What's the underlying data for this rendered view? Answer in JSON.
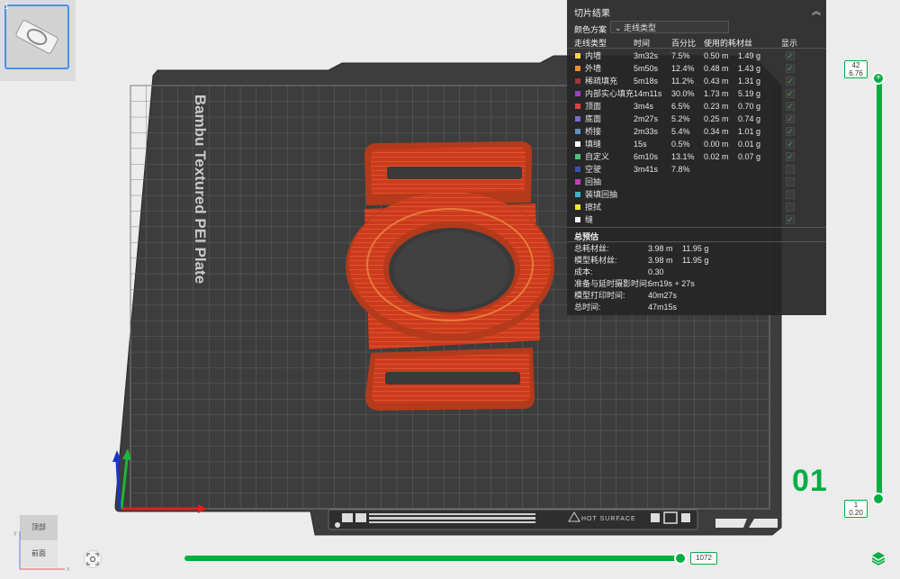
{
  "plate": {
    "thumbnail_number": "1",
    "bed_name": "Bambu Textured PEI Plate",
    "plate_number": "01",
    "hot_surface_label": "HOT SURFACE"
  },
  "stats": {
    "title": "切片结果",
    "scheme_label": "颜色方案",
    "scheme_value": "走线类型",
    "headers": {
      "type": "走线类型",
      "time": "时间",
      "percent": "百分比",
      "usage": "使用的耗材丝",
      "show": "显示"
    },
    "rows": [
      {
        "name": "内墙",
        "time": "3m32s",
        "percent": "7.5%",
        "length": "0.50 m",
        "weight": "1.49 g",
        "color": "#f5d547",
        "shown": true
      },
      {
        "name": "外墙",
        "time": "5m50s",
        "percent": "12.4%",
        "length": "0.48 m",
        "weight": "1.43 g",
        "color": "#f08c2e",
        "shown": true
      },
      {
        "name": "稀疏填充",
        "time": "5m18s",
        "percent": "11.2%",
        "length": "0.43 m",
        "weight": "1.31 g",
        "color": "#a8323a",
        "shown": true
      },
      {
        "name": "内部实心填充",
        "time": "14m11s",
        "percent": "30.0%",
        "length": "1.73 m",
        "weight": "5.19 g",
        "color": "#9b3fc2",
        "shown": true
      },
      {
        "name": "顶面",
        "time": "3m4s",
        "percent": "6.5%",
        "length": "0.23 m",
        "weight": "0.70 g",
        "color": "#e04040",
        "shown": true
      },
      {
        "name": "底面",
        "time": "2m27s",
        "percent": "5.2%",
        "length": "0.25 m",
        "weight": "0.74 g",
        "color": "#7e6ad1",
        "shown": true
      },
      {
        "name": "桥接",
        "time": "2m33s",
        "percent": "5.4%",
        "length": "0.34 m",
        "weight": "1.01 g",
        "color": "#5d8fbf",
        "shown": true
      },
      {
        "name": "填缝",
        "time": "15s",
        "percent": "0.5%",
        "length": "0.00 m",
        "weight": "0.01 g",
        "color": "#ffffff",
        "shown": true
      },
      {
        "name": "自定义",
        "time": "6m10s",
        "percent": "13.1%",
        "length": "0.02 m",
        "weight": "0.07 g",
        "color": "#4fbf7a",
        "shown": true
      },
      {
        "name": "空驶",
        "time": "3m41s",
        "percent": "7.8%",
        "length": "",
        "weight": "",
        "color": "#3b4fb0",
        "shown": false
      },
      {
        "name": "回抽",
        "time": "",
        "percent": "",
        "length": "",
        "weight": "",
        "color": "#c23ec0",
        "shown": false
      },
      {
        "name": "装填回抽",
        "time": "",
        "percent": "",
        "length": "",
        "weight": "",
        "color": "#3bb5c4",
        "shown": false
      },
      {
        "name": "擦拭",
        "time": "",
        "percent": "",
        "length": "",
        "weight": "",
        "color": "#f0e830",
        "shown": false
      },
      {
        "name": "缝",
        "time": "",
        "percent": "",
        "length": "",
        "weight": "",
        "color": "#f2f2f2",
        "shown": true
      }
    ],
    "estimate_title": "总预估",
    "estimates": [
      {
        "label": "总耗材丝:",
        "v1": "3.98 m",
        "v2": "11.95 g"
      },
      {
        "label": "模型耗材丝:",
        "v1": "3.98 m",
        "v2": "11.95 g"
      },
      {
        "label": "成本:",
        "v1": "0.30",
        "v2": ""
      },
      {
        "label": "准备与延时摄影时间:",
        "v1": "6m19s + 27s",
        "v2": ""
      },
      {
        "label": "模型打印时间:",
        "v1": "40m27s",
        "v2": ""
      },
      {
        "label": "总时间:",
        "v1": "47m15s",
        "v2": ""
      }
    ]
  },
  "layer_slider": {
    "top_layer": "42",
    "top_height": "6.76",
    "bottom_layer": "1",
    "bottom_height": "0.20"
  },
  "move_slider": {
    "value": "1072"
  },
  "view_cube": {
    "top": "顶部",
    "front": "前面",
    "x": "x",
    "y": "y"
  },
  "colors": {
    "accent": "#00ae42",
    "part": "#c83a1e"
  }
}
